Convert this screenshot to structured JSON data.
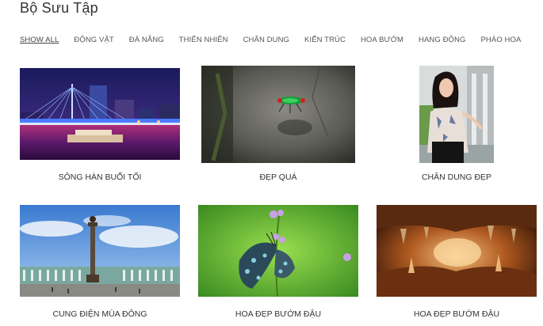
{
  "page": {
    "title": "Bộ Sưu Tập"
  },
  "filters": [
    {
      "label": "SHOW ALL",
      "active": true
    },
    {
      "label": "ĐỘNG VẬT",
      "active": false
    },
    {
      "label": "ĐÀ NẴNG",
      "active": false
    },
    {
      "label": "THIÊN NHIÊN",
      "active": false
    },
    {
      "label": "CHÂN DUNG",
      "active": false
    },
    {
      "label": "KIẾN TRÚC",
      "active": false
    },
    {
      "label": "HOA BƯỚM",
      "active": false
    },
    {
      "label": "HANG ĐỘNG",
      "active": false
    },
    {
      "label": "PHÁO HOA",
      "active": false
    }
  ],
  "gallery": [
    {
      "caption": "SÔNG HÀN BUỔI TỐI",
      "image": "han-river-night-bridge"
    },
    {
      "caption": "ĐẸP QUÁ",
      "image": "green-beetle-on-rock"
    },
    {
      "caption": "CHÂN DUNG ĐẸP",
      "image": "woman-portrait"
    },
    {
      "caption": "CUNG ĐIỆN MÙA ĐÔNG",
      "image": "winter-palace-square"
    },
    {
      "caption": "HOA ĐẸP BƯỚM ĐẬU",
      "image": "butterfly-on-flower"
    },
    {
      "caption": "HOA ĐẸP BƯỚM ĐẬU",
      "image": "cave-interior"
    }
  ]
}
